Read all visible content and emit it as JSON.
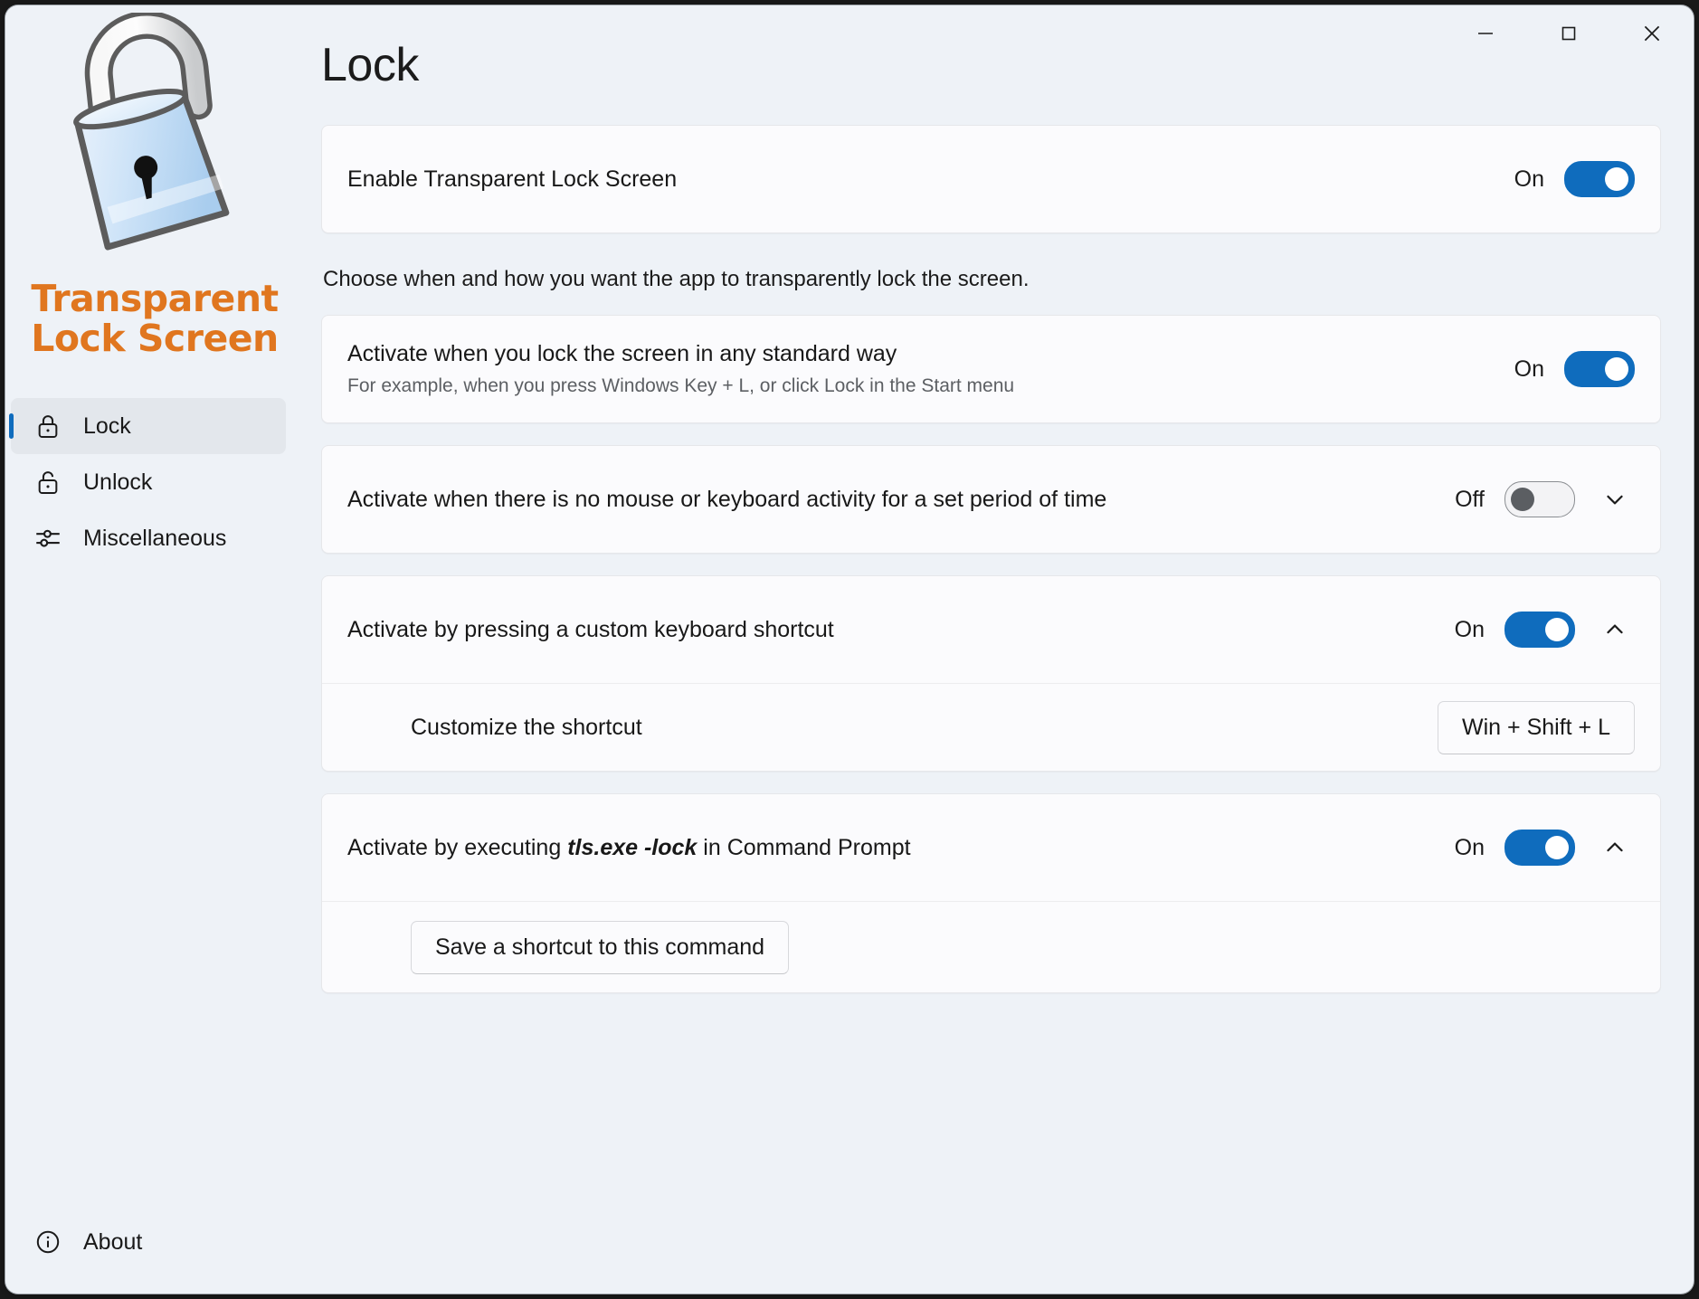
{
  "window": {
    "minimize_label": "Minimize",
    "maximize_label": "Maximize",
    "close_label": "Close"
  },
  "brand": {
    "title_line1": "Transparent",
    "title_line2": "Lock Screen",
    "accent_color": "#e0761f",
    "logo_icon": "padlock-logo"
  },
  "sidebar": {
    "items": [
      {
        "id": "lock",
        "label": "Lock",
        "icon": "lock-closed-icon",
        "active": true
      },
      {
        "id": "unlock",
        "label": "Unlock",
        "icon": "lock-open-icon",
        "active": false
      },
      {
        "id": "misc",
        "label": "Miscellaneous",
        "icon": "sliders-icon",
        "active": false
      }
    ],
    "about": {
      "label": "About",
      "icon": "info-circle-icon"
    }
  },
  "page": {
    "title": "Lock",
    "section_note": "Choose when and how you want the app to transparently lock the screen."
  },
  "settings": {
    "enable": {
      "title": "Enable Transparent Lock Screen",
      "state": "On",
      "toggle_on": true
    },
    "standard_way": {
      "title": "Activate when you lock the screen in any standard way",
      "subtitle": "For example, when you press Windows Key + L, or click Lock in the Start menu",
      "state": "On",
      "toggle_on": true
    },
    "idle": {
      "title": "Activate when there is no mouse or keyboard activity for a set period of time",
      "state": "Off",
      "toggle_on": false,
      "expander_icon": "chevron-down-icon",
      "expanded": false
    },
    "shortcut": {
      "title": "Activate by pressing a custom keyboard shortcut",
      "state": "On",
      "toggle_on": true,
      "expander_icon": "chevron-up-icon",
      "expanded": true,
      "sub_label": "Customize the shortcut",
      "shortcut_value": "Win + Shift + L"
    },
    "command": {
      "title_prefix": "Activate by executing ",
      "title_command": "tls.exe -lock",
      "title_suffix": " in Command Prompt",
      "state": "On",
      "toggle_on": true,
      "expander_icon": "chevron-up-icon",
      "expanded": true,
      "save_button_label": "Save a shortcut to this command"
    }
  },
  "colors": {
    "accent_toggle": "#0f6cbd",
    "window_background": "#eef2f7",
    "card_background": "#fbfbfd",
    "brand_orange": "#e0761f"
  }
}
